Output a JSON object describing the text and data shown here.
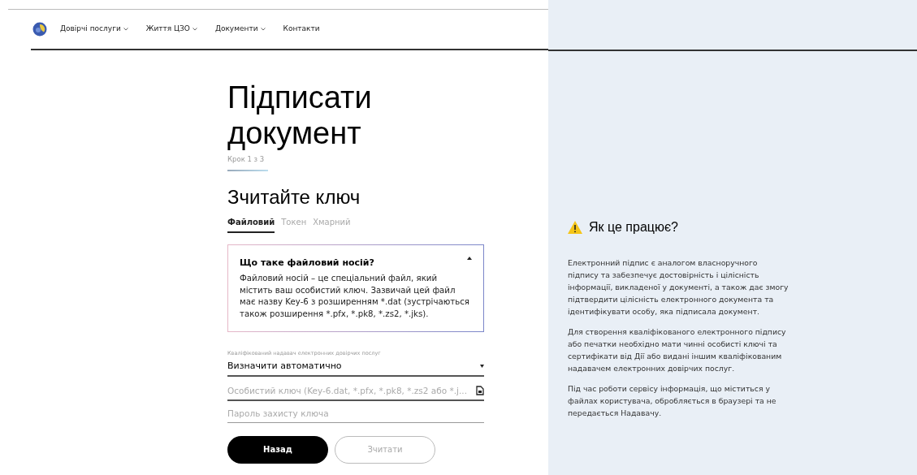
{
  "nav": {
    "items": [
      {
        "label": "Довірчі послуги",
        "dropdown": true
      },
      {
        "label": "Життя ЦЗО",
        "dropdown": true
      },
      {
        "label": "Документи",
        "dropdown": true
      },
      {
        "label": "Контакти",
        "dropdown": false
      }
    ]
  },
  "title": "Підписати документ",
  "step": "Крок 1 з 3",
  "subtitle": "Зчитайте ключ",
  "tabs": [
    {
      "label": "Файловий",
      "selected": true
    },
    {
      "label": "Токен",
      "selected": false
    },
    {
      "label": "Хмарний",
      "selected": false
    }
  ],
  "info_box": {
    "title": "Що таке файловий носій?",
    "expanded": true,
    "text": "Файловий носій – це спеціальний файл, який містить ваш особистий ключ. Зазвичай цей файл має назву Key-6 з розширенням *.dat (зустрічаються також розширення *.pfx, *.pk8, *.zs2, *.jks)."
  },
  "provider_select": {
    "label": "Кваліфікований надавач електронних довірчих послуг",
    "value": "Визначити автоматично"
  },
  "key_field": {
    "placeholder": "Особистий ключ (Key-6.dat, *.pfx, *.pk8, *.zs2 або *.j..."
  },
  "password_field": {
    "placeholder": "Пароль захисту ключа"
  },
  "buttons": [
    {
      "label": "Назад",
      "disabled": false,
      "kind": "primary"
    },
    {
      "label": "Зчитати",
      "disabled": true,
      "kind": "outline"
    }
  ],
  "help": {
    "title": "Як це працює?",
    "paragraphs": [
      "Електронний підпис є аналогом власноручного підпису та забезпечує достовірність і цілісність інформації, викладеної у документі, а також дає змогу підтвердити цілісність електронного документа та ідентифікувати особу, яка підписала документ.",
      "Для створення кваліфікованого електронного підпису або печатки необхідно мати чинні особисті ключі та сертифікати від Дії або видані іншим кваліфікованим надавачем електронних довірчих послуг.",
      "Під час роботи сервісу інформація, що міститься у файлах користувача, обробляється в браузері та не передається Надавачу."
    ]
  }
}
